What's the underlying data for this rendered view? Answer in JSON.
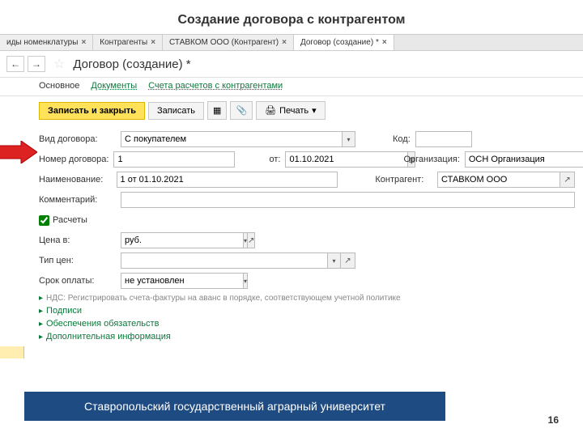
{
  "slide": {
    "title": "Создание договора с контрагентом",
    "page": "16"
  },
  "footer": {
    "text": "Ставропольский государственный аграрный университет"
  },
  "tabs": {
    "t0": "иды номенклатуры",
    "t1": "Контрагенты",
    "t2": "СТАВКОМ ООО (Контрагент)",
    "t3": "Договор (создание) *",
    "close": "×"
  },
  "header": {
    "title": "Договор (создание) *"
  },
  "subnav": {
    "main": "Основное",
    "docs": "Документы",
    "accounts": "Счета расчетов с контрагентами"
  },
  "actions": {
    "save_close": "Записать и закрыть",
    "save": "Записать",
    "print": "Печать"
  },
  "form": {
    "contract_type": {
      "label": "Вид договора:",
      "value": "С покупателем"
    },
    "code": {
      "label": "Код:",
      "value": ""
    },
    "number": {
      "label": "Номер договора:",
      "value": "1"
    },
    "from": {
      "label": "от:",
      "value": "01.10.2021"
    },
    "org": {
      "label": "Организация:",
      "value": "ОСН Организация"
    },
    "name": {
      "label": "Наименование:",
      "value": "1 от 01.10.2021"
    },
    "counterparty": {
      "label": "Контрагент:",
      "value": "СТАВКОМ ООО"
    },
    "comment": {
      "label": "Комментарий:",
      "value": ""
    },
    "calcs": {
      "label": "Расчеты"
    },
    "price_in": {
      "label": "Цена в:",
      "value": "руб."
    },
    "price_type": {
      "label": "Тип цен:",
      "value": ""
    },
    "pay_term": {
      "label": "Срок оплаты:",
      "value": "не установлен"
    },
    "nds_note": "НДС: Регистрировать счета-фактуры на аванс в порядке, соответствующем учетной политике",
    "exp1": "Подписи",
    "exp2": "Обеспечения обязательств",
    "exp3": "Дополнительная информация"
  }
}
